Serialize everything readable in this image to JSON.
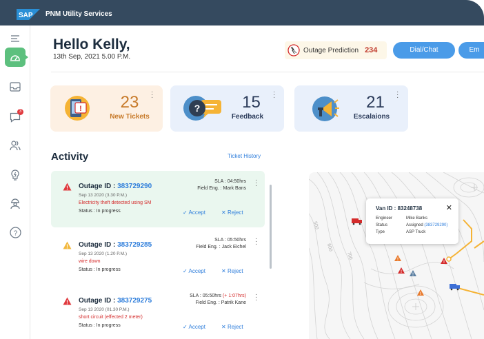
{
  "shell": {
    "logo_text": "SAP",
    "app_title": "PNM Utility Services"
  },
  "nav": {
    "items": [
      {
        "icon": "menu-icon"
      },
      {
        "icon": "dashboard-icon",
        "active": true
      },
      {
        "icon": "inbox-icon"
      },
      {
        "icon": "chat-icon",
        "badge": "3"
      },
      {
        "icon": "users-icon"
      },
      {
        "icon": "lightbulb-icon"
      },
      {
        "icon": "engineer-icon"
      },
      {
        "icon": "help-icon"
      }
    ]
  },
  "header": {
    "greeting": "Hello Kelly,",
    "datetime": "13th Sep, 2021  5.00 P.M.",
    "prediction_label": "Outage Prediction",
    "prediction_count": "234",
    "dial_chat": "Dial/Chat",
    "email": "Em"
  },
  "cards": [
    {
      "count": "23",
      "label": "New Tickets",
      "bg": "#fdf0e3",
      "color": "#c77a2a"
    },
    {
      "count": "15",
      "label": "Feedback",
      "bg": "#e9f0fb",
      "color": "#2b3b5a"
    },
    {
      "count": "21",
      "label": "Escalaions",
      "bg": "#e9f0fb",
      "color": "#2b3b5a"
    }
  ],
  "activity": {
    "title": "Activity",
    "history_link": "Ticket History",
    "items": [
      {
        "label": "Outage ID :",
        "id": "383729290",
        "date": "Sep 13 2020 (3.30 P.M.)",
        "desc": "Electricity theft detected using SM",
        "status": "Status  :  In progress",
        "sla": "SLA : 04:50hrs",
        "sla_extra": "",
        "engineer": "Field Eng. :  Mark Bans",
        "accept": "Accept",
        "reject": "Reject",
        "severity_color": "#e0393e",
        "selected": true
      },
      {
        "label": "Outage ID :",
        "id": "383729285",
        "date": "Sep 13 2020 (1.20 P.M.)",
        "desc": "wire down",
        "status": "Status  :  In progress",
        "sla": "SLA : 05:50hrs",
        "sla_extra": "",
        "engineer": "Field Eng. :  Jack Eichel",
        "accept": "Accept",
        "reject": "Reject",
        "severity_color": "#f2b83e",
        "selected": false
      },
      {
        "label": "Outage ID :",
        "id": "383729275",
        "date": "Sep 13 2020 (01.30 P.M.)",
        "desc": "short circuit  (effected 2 meter)",
        "status": "Status  :  In progress",
        "sla": "SLA : 05:50hrs",
        "sla_extra": "(+ 1:07hrs)",
        "engineer": "Field Eng. :  Patrik Kane",
        "accept": "Accept",
        "reject": "Reject",
        "severity_color": "#e0393e",
        "selected": false
      }
    ]
  },
  "map": {
    "contour_labels": [
      "500",
      "600",
      "700"
    ],
    "popup": {
      "title": "Van ID : 83248738",
      "rows": [
        {
          "key": "Engineer",
          "value": "Mike Banks",
          "link": ""
        },
        {
          "key": "Status",
          "value": "Assigned",
          "link": "(383729290)"
        },
        {
          "key": "Type",
          "value": "ASP Truck",
          "link": ""
        }
      ]
    }
  }
}
